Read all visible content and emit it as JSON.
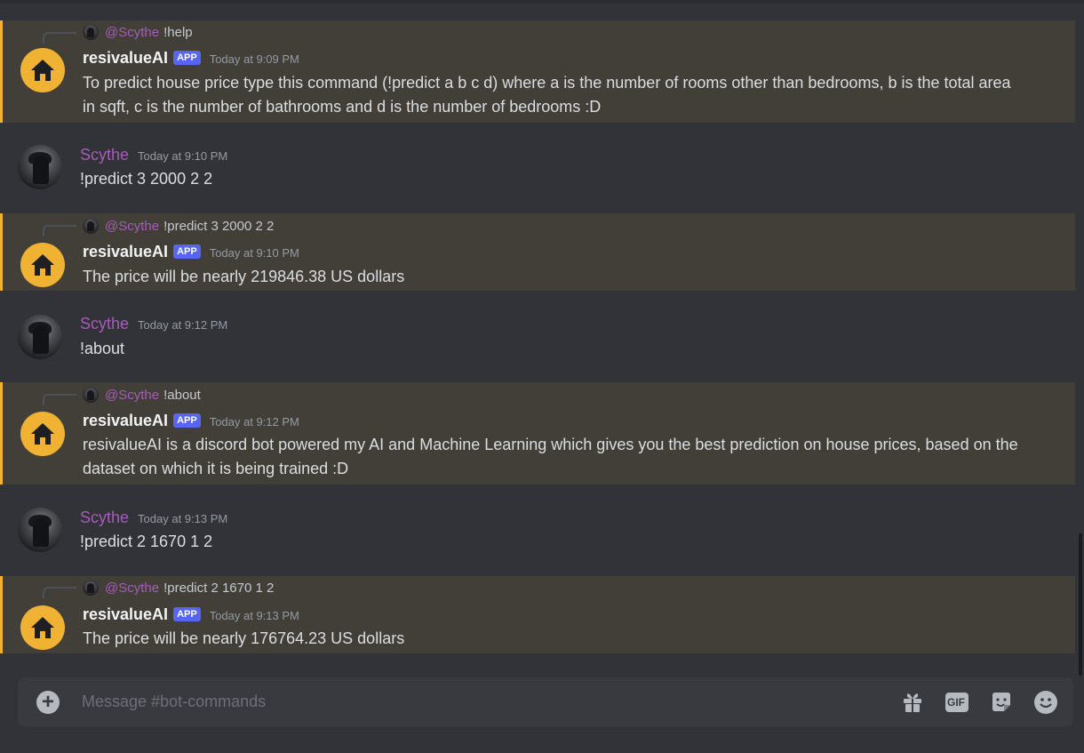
{
  "messages": [
    {
      "type": "bot",
      "reply_to": {
        "name": "@Scythe",
        "text": "!help"
      },
      "author": "resivalueAI",
      "badge": "APP",
      "time": "Today at 9:09 PM",
      "text": "To predict house price type this command (!predict a b c d) where a is the number of rooms other than bedrooms, b is the total area in sqft, c is the number of bathrooms and d is the number of bedrooms :D"
    },
    {
      "type": "user",
      "author": "Scythe",
      "time": "Today at 9:10 PM",
      "text": "!predict 3 2000 2 2"
    },
    {
      "type": "bot",
      "reply_to": {
        "name": "@Scythe",
        "text": "!predict 3 2000 2 2"
      },
      "author": "resivalueAI",
      "badge": "APP",
      "time": "Today at 9:10 PM",
      "text": "The price will be nearly 219846.38 US dollars"
    },
    {
      "type": "user",
      "author": "Scythe",
      "time": "Today at 9:12 PM",
      "text": "!about"
    },
    {
      "type": "bot",
      "reply_to": {
        "name": "@Scythe",
        "text": "!about"
      },
      "author": "resivalueAI",
      "badge": "APP",
      "time": "Today at 9:12 PM",
      "text": "resivalueAI is a discord bot powered my AI and Machine Learning which gives you the best prediction on house prices, based on the dataset on which it is being trained :D"
    },
    {
      "type": "user",
      "author": "Scythe",
      "time": "Today at 9:13 PM",
      "text": "!predict 2 1670 1 2"
    },
    {
      "type": "bot",
      "reply_to": {
        "name": "@Scythe",
        "text": "!predict 2 1670 1 2"
      },
      "author": "resivalueAI",
      "badge": "APP",
      "time": "Today at 9:13 PM",
      "text": "The price will be nearly 176764.23 US dollars"
    }
  ],
  "composer": {
    "placeholder": "Message #bot-commands",
    "gif_label": "GIF",
    "icons": [
      "plus-circle-icon",
      "gift-icon",
      "gif-icon",
      "sticker-icon",
      "emoji-icon"
    ]
  },
  "colors": {
    "background": "#313338",
    "mention_highlight": "#423f39",
    "mention_bar": "#f0b232",
    "username": "#a45db8",
    "app_badge": "#5865f2",
    "bot_avatar": "#f0b232"
  }
}
